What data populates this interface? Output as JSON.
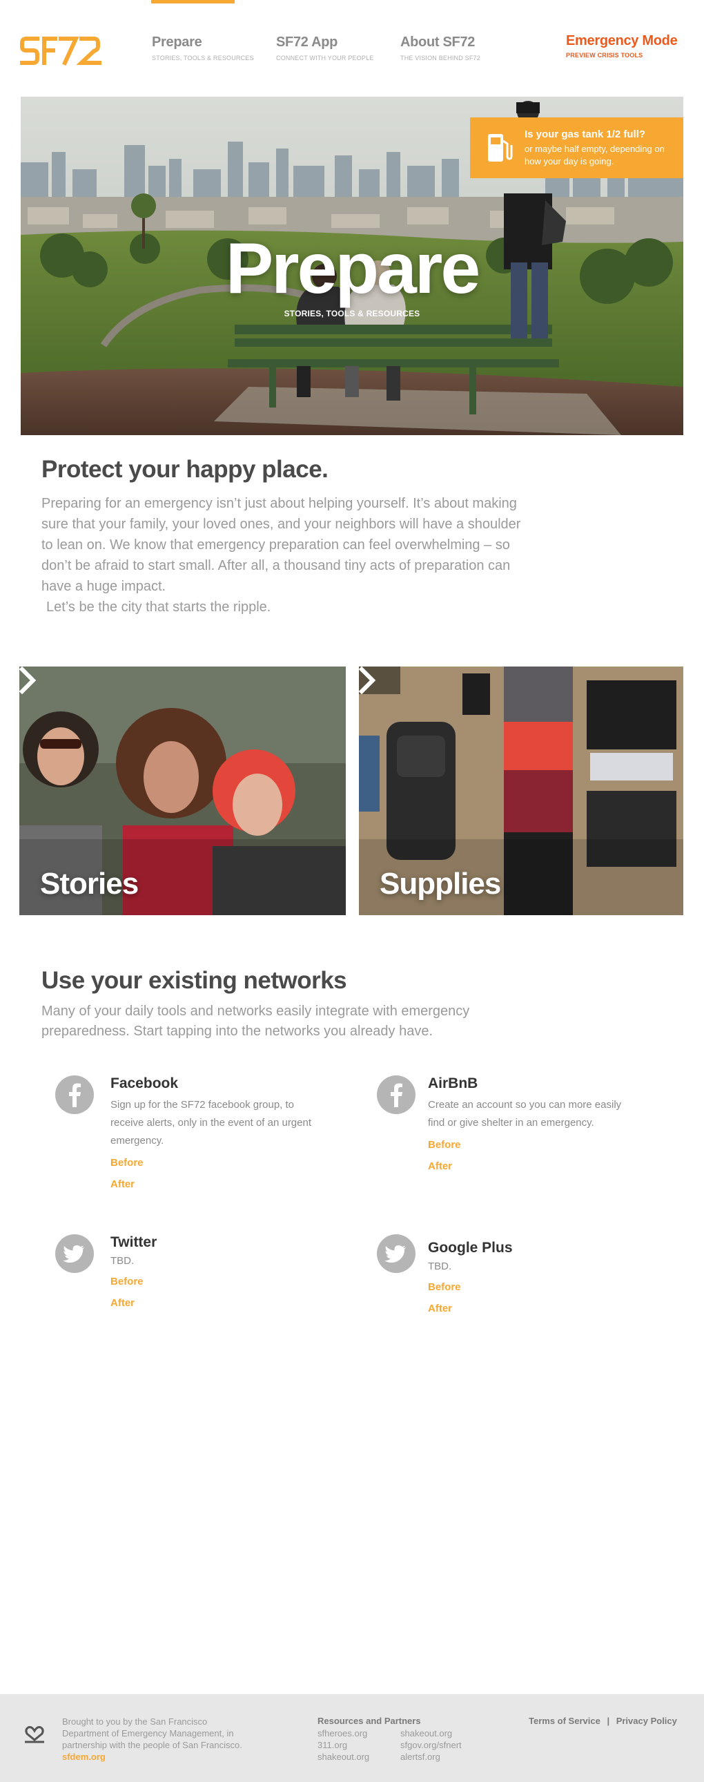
{
  "header": {
    "logo_text": "SF72",
    "nav": [
      {
        "title": "Prepare",
        "subtitle": "STORIES, TOOLS & RESOURCES"
      },
      {
        "title": "SF72 App",
        "subtitle": "CONNECT WITH YOUR PEOPLE"
      },
      {
        "title": "About SF72",
        "subtitle": "THE VISION BEHIND SF72"
      }
    ],
    "emergency": {
      "title": "Emergency Mode",
      "subtitle": "PREVIEW CRISIS TOOLS"
    }
  },
  "hero": {
    "title": "Prepare",
    "subtitle": "STORIES, TOOLS & RESOURCES",
    "gas_card": {
      "title": "Is your gas tank 1/2 full?",
      "text": "or maybe half empty, depending on how your day is going."
    }
  },
  "intro": {
    "heading": "Protect your happy place.",
    "body": "Preparing for an emergency isn’t just about helping yourself. It’s about making sure that your family, your loved ones, and your neighbors will have a shoulder to lean on. We know that emergency preparation can feel overwhelming – so don’t be afraid to start small. After all, a thousand tiny acts of preparation can have a huge impact.",
    "ripple": "Let’s be the city that starts the ripple."
  },
  "tiles": [
    {
      "label": "Stories"
    },
    {
      "label": "Supplies"
    }
  ],
  "networks": {
    "heading": "Use your existing networks",
    "lead": "Many of your daily tools and networks easily integrate with emergency preparedness. Start tapping into the networks you already have.",
    "items": [
      {
        "name": "Facebook",
        "icon": "facebook-icon",
        "desc": "Sign up for the SF72 facebook group, to receive alerts, only in the event of an urgent emergency.",
        "before": "Before",
        "after": "After"
      },
      {
        "name": "AirBnB",
        "icon": "facebook-icon",
        "desc": "Create an account so you can more easily find or give shelter in an emergency.",
        "before": "Before",
        "after": "After"
      },
      {
        "name": "Twitter",
        "icon": "twitter-icon",
        "desc": "TBD.",
        "before": "Before",
        "after": "After"
      },
      {
        "name": "Google Plus",
        "icon": "twitter-icon",
        "desc": "TBD.",
        "before": "Before",
        "after": "After"
      }
    ]
  },
  "footer": {
    "brought_by": "Brought to you by the San Francisco Department of Emergency Management, in partnership with the people of San Francisco.",
    "brought_link": "sfdem.org",
    "resources_title": "Resources and Partners",
    "resources_col1": [
      "sfheroes.org",
      "311.org",
      "shakeout.org"
    ],
    "resources_col2": [
      "shakeout.org",
      "sfgov.org/sfnert",
      "alertsf.org"
    ],
    "terms": "Terms of Service",
    "separator": "|",
    "privacy": "Privacy Policy"
  },
  "colors": {
    "accent": "#f7a833",
    "emergency": "#ea5a1c",
    "footer_bg": "#e7e7e7"
  }
}
